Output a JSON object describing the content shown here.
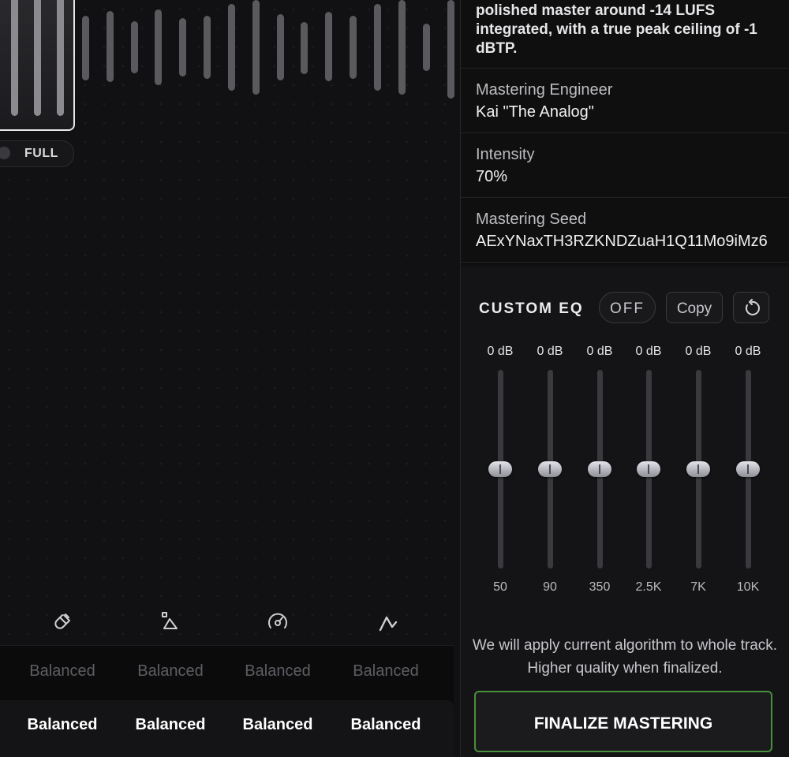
{
  "player": {
    "view_mode_label": "FULL"
  },
  "controls": {
    "icons": [
      "magnet-icon",
      "shape-icon",
      "gauge-icon",
      "peak-icon"
    ],
    "presets_top": [
      "Balanced",
      "Balanced",
      "Balanced",
      "Balanced"
    ],
    "presets_bottom": [
      "Balanced",
      "Balanced",
      "Balanced",
      "Balanced"
    ]
  },
  "info": {
    "description": "polished master around -14 LUFS integrated, with a true peak ceiling of -1 dBTP.",
    "engineer_label": "Mastering Engineer",
    "engineer_value": "Kai \"The Analog\"",
    "intensity_label": "Intensity",
    "intensity_value": "70%",
    "seed_label": "Mastering Seed",
    "seed_value": "AExYNaxTH3RZKNDZuaH1Q11Mo9iMz6"
  },
  "eq": {
    "title": "CUSTOM EQ",
    "toggle_label": "OFF",
    "copy_label": "Copy",
    "reset_icon": "reset-icon",
    "bands": [
      {
        "gain_label": "0 dB",
        "freq": "50",
        "level": 0.5
      },
      {
        "gain_label": "0 dB",
        "freq": "90",
        "level": 0.5
      },
      {
        "gain_label": "0 dB",
        "freq": "350",
        "level": 0.5
      },
      {
        "gain_label": "0 dB",
        "freq": "2.5K",
        "level": 0.5
      },
      {
        "gain_label": "0 dB",
        "freq": "7K",
        "level": 0.5
      },
      {
        "gain_label": "0 dB",
        "freq": "10K",
        "level": 0.5
      }
    ]
  },
  "footer": {
    "note": "We will apply current algorithm to whole track. Higher quality when finalized.",
    "finalize_label": "FINALIZE MASTERING"
  },
  "colors": {
    "accent_border": "#4a8f3c",
    "background": "#0f0f10"
  }
}
